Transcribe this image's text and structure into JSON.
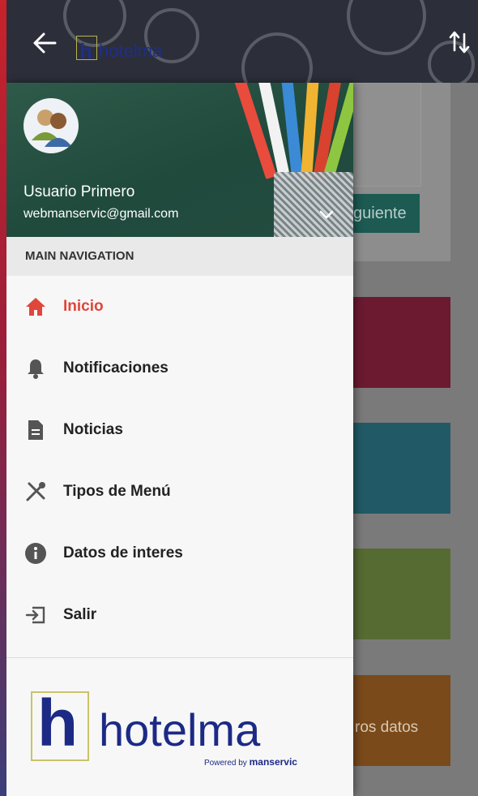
{
  "app_bar": {
    "brand": "hotelma",
    "back_icon": "arrow-left-icon",
    "sort_icon": "sort-arrows-icon",
    "color": "#2c2f3a"
  },
  "user": {
    "name": "Usuario Primero",
    "email": "webmanservic@gmail.com",
    "avatar_icon": "users-avatar-icon"
  },
  "navigation": {
    "header": "MAIN NAVIGATION",
    "items": [
      {
        "label": "Inicio",
        "icon": "home-icon",
        "active": true
      },
      {
        "label": "Notificaciones",
        "icon": "bell-icon",
        "active": false
      },
      {
        "label": "Noticias",
        "icon": "document-icon",
        "active": false
      },
      {
        "label": "Tipos de Menú",
        "icon": "utensils-icon",
        "active": false
      },
      {
        "label": "Datos de interes",
        "icon": "info-icon",
        "active": false
      },
      {
        "label": "Salir",
        "icon": "logout-icon",
        "active": false
      }
    ]
  },
  "footer": {
    "brand": "hotelma",
    "powered_by": "Powered by",
    "powered_brand": "manservic"
  },
  "background": {
    "button_label": "guiente",
    "tile_label": "ros datos",
    "tile_colors": [
      "#6b1a30",
      "#215a66",
      "#566b32",
      "#7a4a1a"
    ]
  },
  "colors": {
    "accent": "#e0463a",
    "brand_blue": "#1c2a86"
  }
}
